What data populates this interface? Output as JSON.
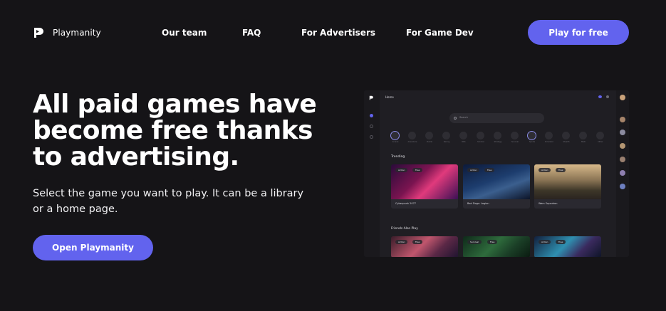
{
  "header": {
    "brand": "Playmanity",
    "nav": [
      "Our team",
      "FAQ",
      "For Advertisers",
      "For Game Dev"
    ],
    "cta_label": "Play for free"
  },
  "hero": {
    "headline": "All paid games have become free thanks to advertising.",
    "subtitle": "Select the game you want to play. It can be a library or a home page.",
    "button_label": "Open Playmanity"
  },
  "preview": {
    "page_title": "Home",
    "search_placeholder": "Search",
    "categories": [
      "Arcade",
      "Adventure",
      "Puzzle",
      "Racing",
      "RPG",
      "Shooter",
      "Strategy",
      "Survival",
      "Sports",
      "Simulator",
      "Stealth",
      "Multi",
      "Other"
    ],
    "sections": {
      "trending": "Trending",
      "friends": "Friends Also Play"
    },
    "trending_cards": [
      {
        "title": "Cyberpunk 2077",
        "tag1": "Action",
        "tag2": "Free"
      },
      {
        "title": "Bad Dogs: Legion",
        "tag1": "Action",
        "tag2": "Free"
      },
      {
        "title": "Wars Squadron",
        "tag1": "Action",
        "tag2": "Free"
      }
    ],
    "friends_cards": [
      {
        "tag1": "Action",
        "tag2": "Free"
      },
      {
        "tag1": "Survival",
        "tag2": "Free"
      },
      {
        "tag1": "Action",
        "tag2": "Free"
      }
    ]
  },
  "colors": {
    "background": "#151417",
    "accent": "#6263ee",
    "text": "#ffffff"
  }
}
